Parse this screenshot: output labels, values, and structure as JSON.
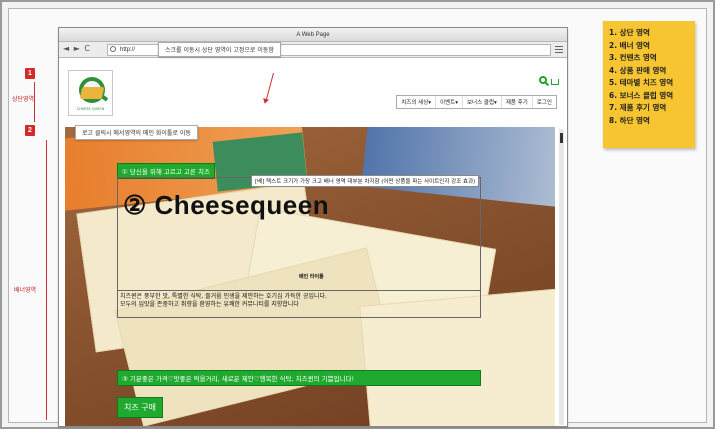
{
  "annotations": {
    "badge_1": "1",
    "badge_2": "2",
    "header_area_label": "상단영역",
    "banner_area_label": "배너영역"
  },
  "browser": {
    "title": "A Web Page",
    "nav_buttons": "◄ ► C",
    "url": "http://",
    "scroll_tooltip": "스크롤 이동시 상단 영역이 고정으로 이동함"
  },
  "header": {
    "logo_text": "CHEESE QUEEN",
    "logo_tooltip": "로고 클릭시 메서영역의 메인 화이툴로 이동",
    "gnb": [
      "치즈의 세상▾",
      "이벤트▾",
      "보너스 클럽▾",
      "제품 후기",
      "로그인"
    ]
  },
  "banner": {
    "slogan": "① 당신을 위해 고르고 고른 치즈",
    "size_note": "[배] 텍스트 크기가 가장 크고 배너 영역 대부분 차지함 (어떤 상품을 파는 사이트인지 강조 효과)",
    "big_title": "② Cheesequeen",
    "main_image_caption": "배인 타이틀",
    "desc_line1": "치즈퀸은 풍부한 맛, 특별한 식탁, 즐거움 인생을 제안하는 호기심 가득한 공입니다.",
    "desc_line2": "모두의 입맛을 존중하고 취향을 환영하는 유쾌한 커뮤니티를 지향합니다",
    "bottom_slogan": "③ 기분좋은 가격♡맛좋은 먹을거리, 새로운 제안♡행복한 식탁, 치즈퀸의 기쁨입니다!",
    "buy_button": "치즈 구매"
  },
  "sticky_note": {
    "items": [
      "1. 상단 영역",
      "2. 배너 영역",
      "3. 컨텐츠 영역",
      "4. 상품 판매 영역",
      "5. 테마별 치즈 영역",
      "6. 보너스 클럽 영역",
      "7. 제품 후기 영역",
      "8. 하단 영역"
    ]
  },
  "colors": {
    "accent_green": "#1faa2f",
    "sticky_yellow": "#f6c531",
    "annotation_red": "#d42a2a"
  }
}
